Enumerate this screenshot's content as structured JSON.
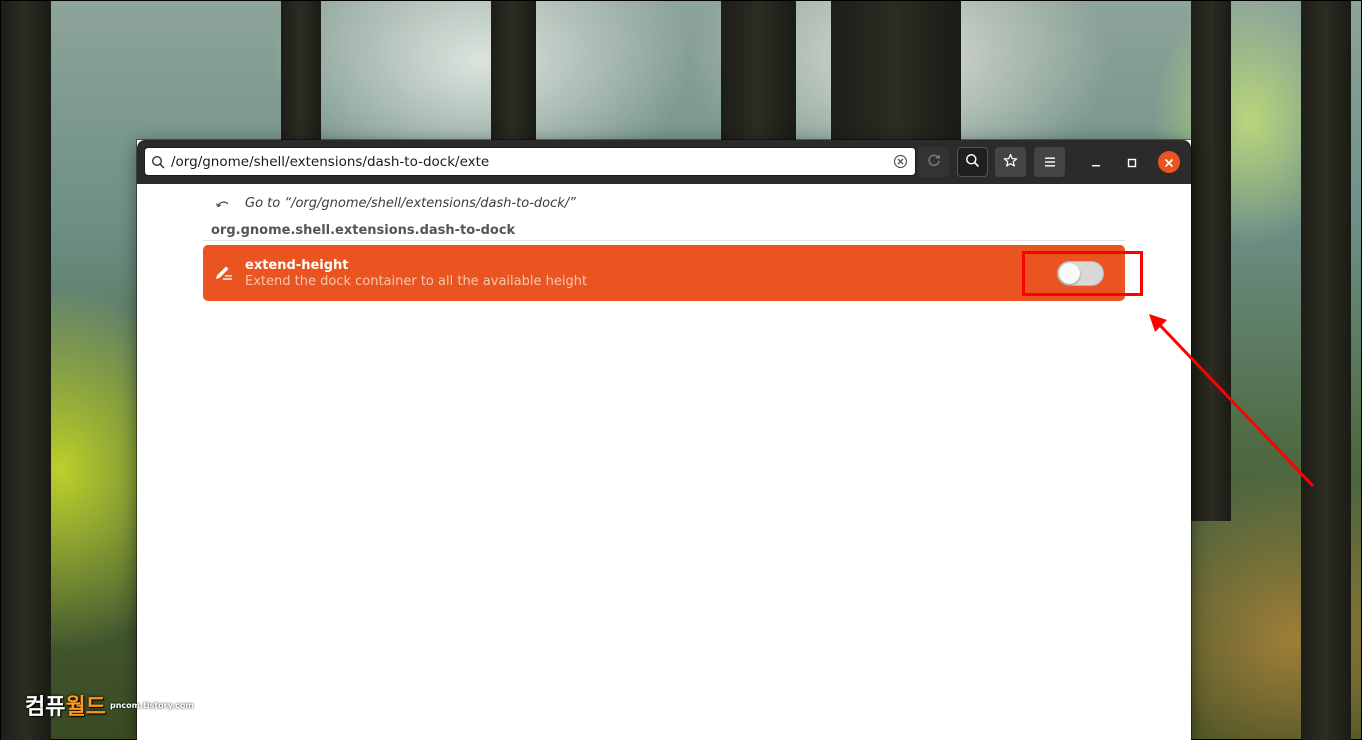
{
  "search": {
    "value": "/org/gnome/shell/extensions/dash-to-dock/exte",
    "placeholder": ""
  },
  "toolbar": {
    "reload_icon": "reload-icon",
    "search_icon": "search-icon",
    "bookmark_icon": "star-icon",
    "menu_icon": "hamburger-menu-icon"
  },
  "window_controls": {
    "minimize_icon": "minimize-icon",
    "maximize_icon": "maximize-icon",
    "close_icon": "close-icon"
  },
  "results": {
    "goto_label": "Go to “/org/gnome/shell/extensions/dash-to-dock/”",
    "schema_title": "org.gnome.shell.extensions.dash-to-dock",
    "items": [
      {
        "key": "extend-height",
        "summary": "Extend the dock container to all the available height",
        "enabled": false
      }
    ]
  },
  "watermark": {
    "brand_part1": "컴퓨",
    "brand_part2": "월드",
    "site": "pncom.tistory.com"
  },
  "colors": {
    "accent": "#e95420",
    "headerbar": "#2b2b2b",
    "annotation": "#ff0000"
  }
}
